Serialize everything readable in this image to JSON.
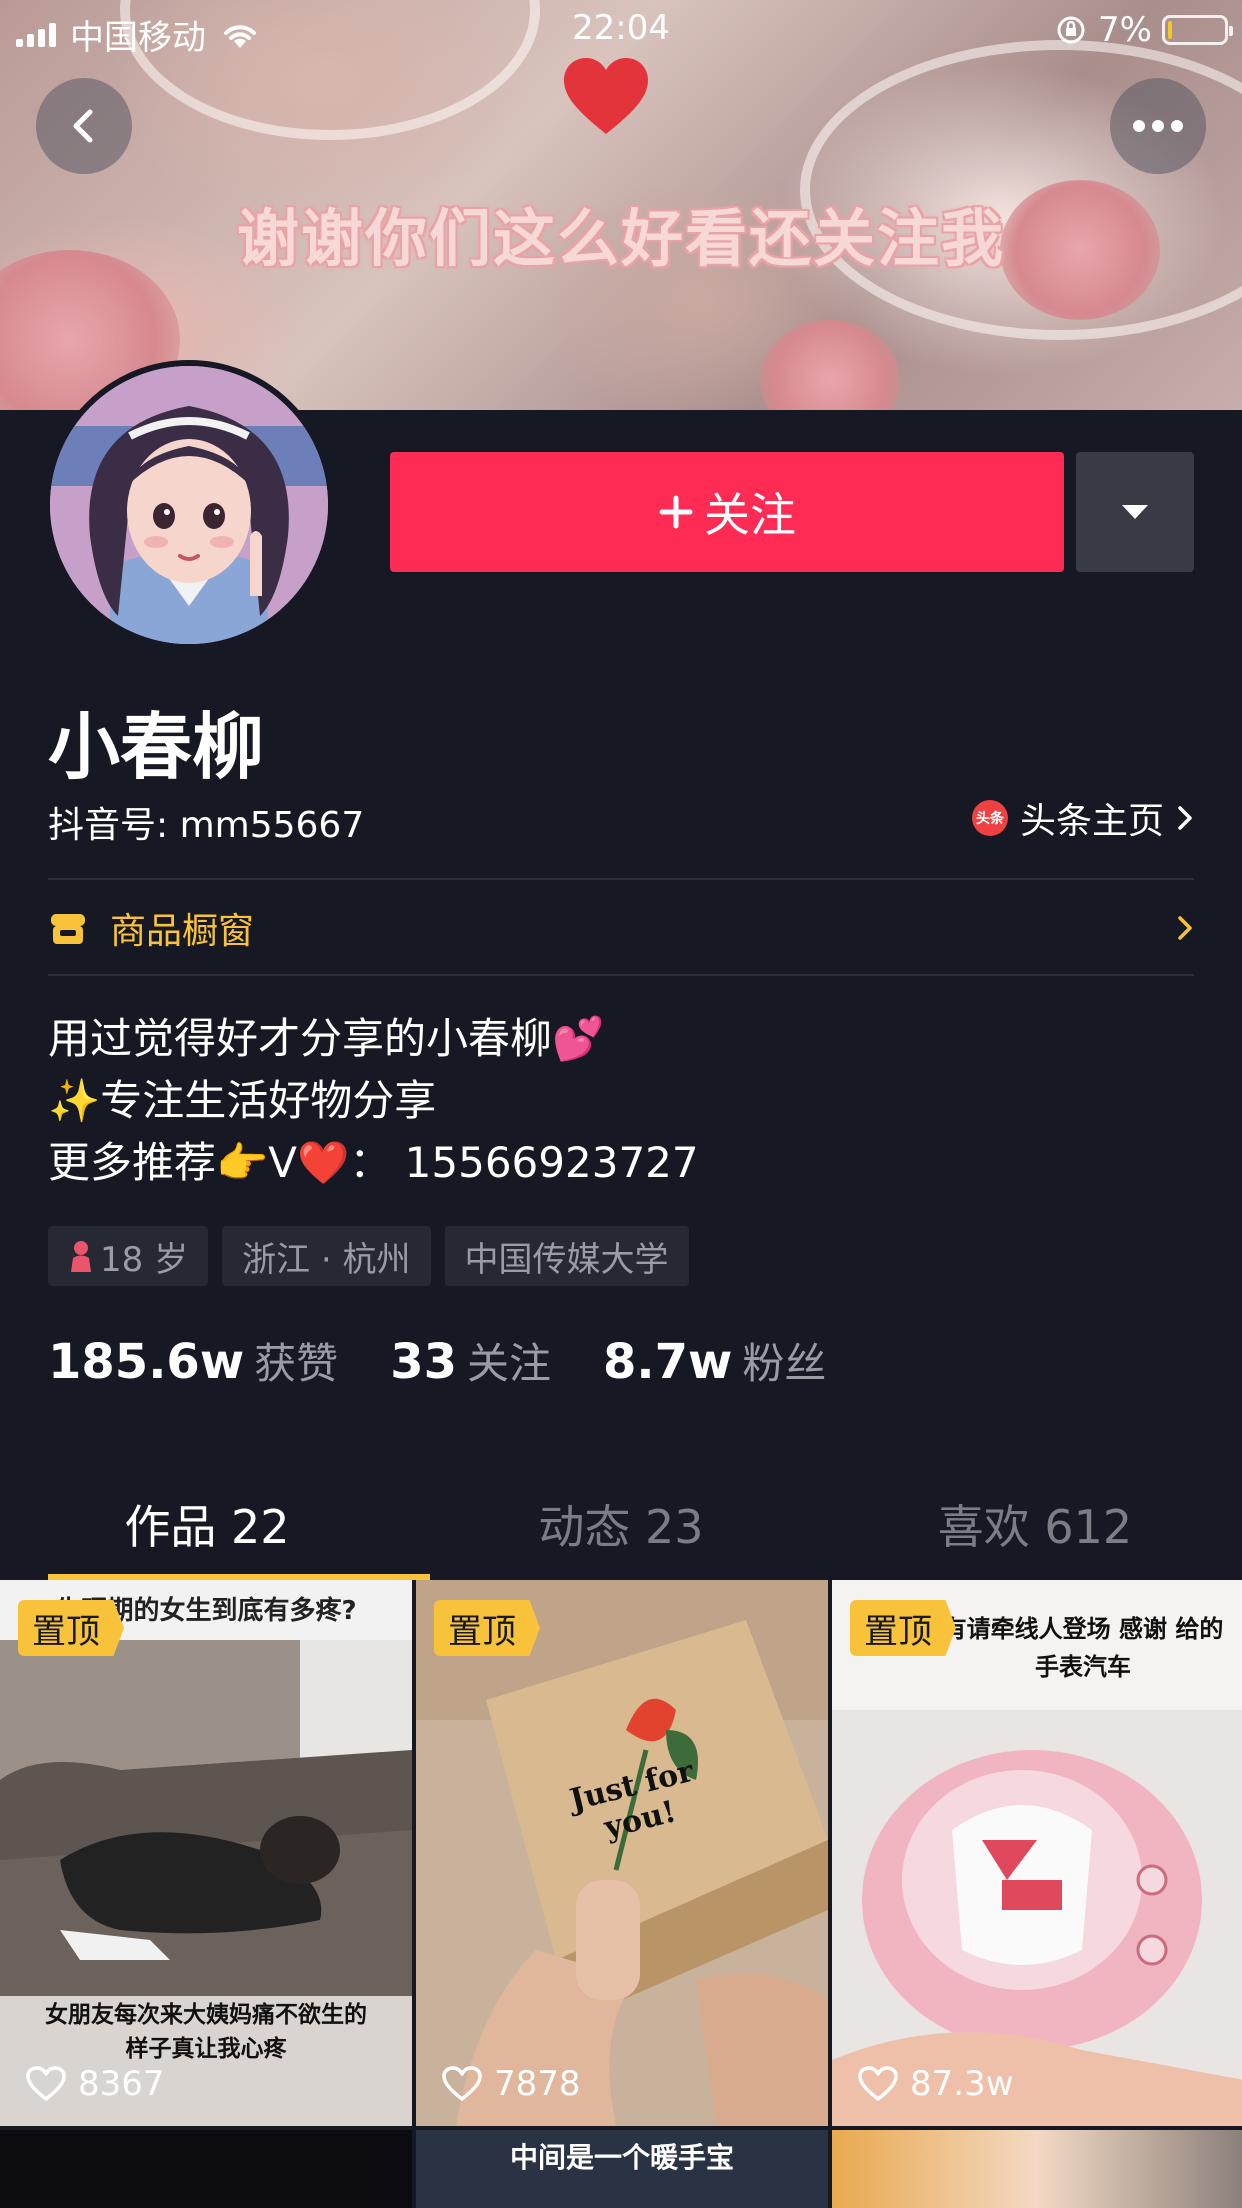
{
  "status_bar": {
    "carrier": "中国移动",
    "time": "22:04",
    "battery": "7%",
    "battery_level": 0.07
  },
  "banner": {
    "caption": "谢谢你们这么好看还关注我"
  },
  "profile": {
    "follow_label": "关注",
    "nickname": "小春柳",
    "douyin_id": "抖音号: mm55667",
    "toutiao_link": "头条主页",
    "toutiao_icon_text": "头条",
    "shop_label": "商品橱窗",
    "bio": [
      "用过觉得好才分享的小春柳💕",
      "✨专注生活好物分享",
      "更多推荐👉V❤️： 15566923727"
    ],
    "tags": [
      "18 岁",
      "浙江 · 杭州",
      "中国传媒大学"
    ]
  },
  "stats": [
    {
      "num": "185.6w",
      "label": "获赞"
    },
    {
      "num": "33",
      "label": "关注"
    },
    {
      "num": "8.7w",
      "label": "粉丝"
    }
  ],
  "tabs": [
    "作品 22",
    "动态 23",
    "喜欢 612"
  ],
  "videos": [
    {
      "pin": "置顶",
      "top_text": "生理期的女生到底有多疼?",
      "bottom_text": "女朋友每次来大姨妈痛不欲生的样子真让我心疼",
      "likes": "8367"
    },
    {
      "pin": "置顶",
      "card_text": "Just for you!",
      "likes": "7878"
    },
    {
      "pin": "置顶",
      "top_text": "有请牵线人登场 感谢 给的手表汽车",
      "likes": "87.3w"
    }
  ],
  "next_row": {
    "caption": "中间是一个暖手宝"
  }
}
